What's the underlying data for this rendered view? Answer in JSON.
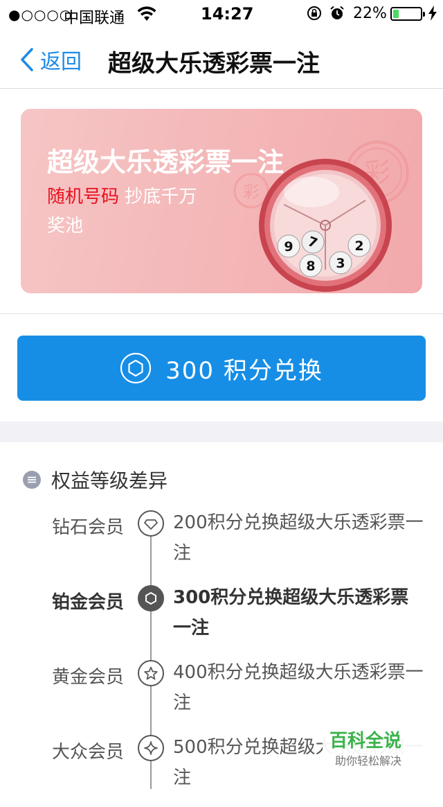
{
  "status_bar": {
    "signal": "●○○○○",
    "carrier": "中国联通",
    "time": "14:27",
    "battery": "22%",
    "battery_level": 0.22
  },
  "nav": {
    "back_label": "返回",
    "title": "超级大乐透彩票一注"
  },
  "banner": {
    "title": "超级大乐透彩票一注",
    "highlight": "随机号码",
    "subtitle": " 抄底千万",
    "subtitle2": "奖池",
    "stamp_char": "彩",
    "balls": [
      "9",
      "7",
      "8",
      "3",
      "2"
    ]
  },
  "redeem_button": {
    "label": "300 积分兑换",
    "icon": "hexagon-badge-icon"
  },
  "tiers": {
    "heading": "权益等级差异",
    "heading_icon": "message-icon",
    "items": [
      {
        "name": "钻石会员",
        "icon": "diamond-icon",
        "desc": "200积分兑换超级大乐透彩票一注"
      },
      {
        "name": "铂金会员",
        "icon": "hexagon-icon",
        "desc": "300积分兑换超级大乐透彩票一注"
      },
      {
        "name": "黄金会员",
        "icon": "star-icon",
        "desc": "400积分兑换超级大乐透彩票一注"
      },
      {
        "name": "大众会员",
        "icon": "sparkle-icon",
        "desc": "500积分兑换超级大乐透彩票一注"
      }
    ]
  },
  "watermark": {
    "title": "百科全说",
    "subtitle": "助你轻松解决"
  },
  "colors": {
    "accent": "#178ee6",
    "banner_highlight": "#e8101d",
    "banner_bg": "#f4b7b8",
    "watermark": "#3bb34a"
  }
}
